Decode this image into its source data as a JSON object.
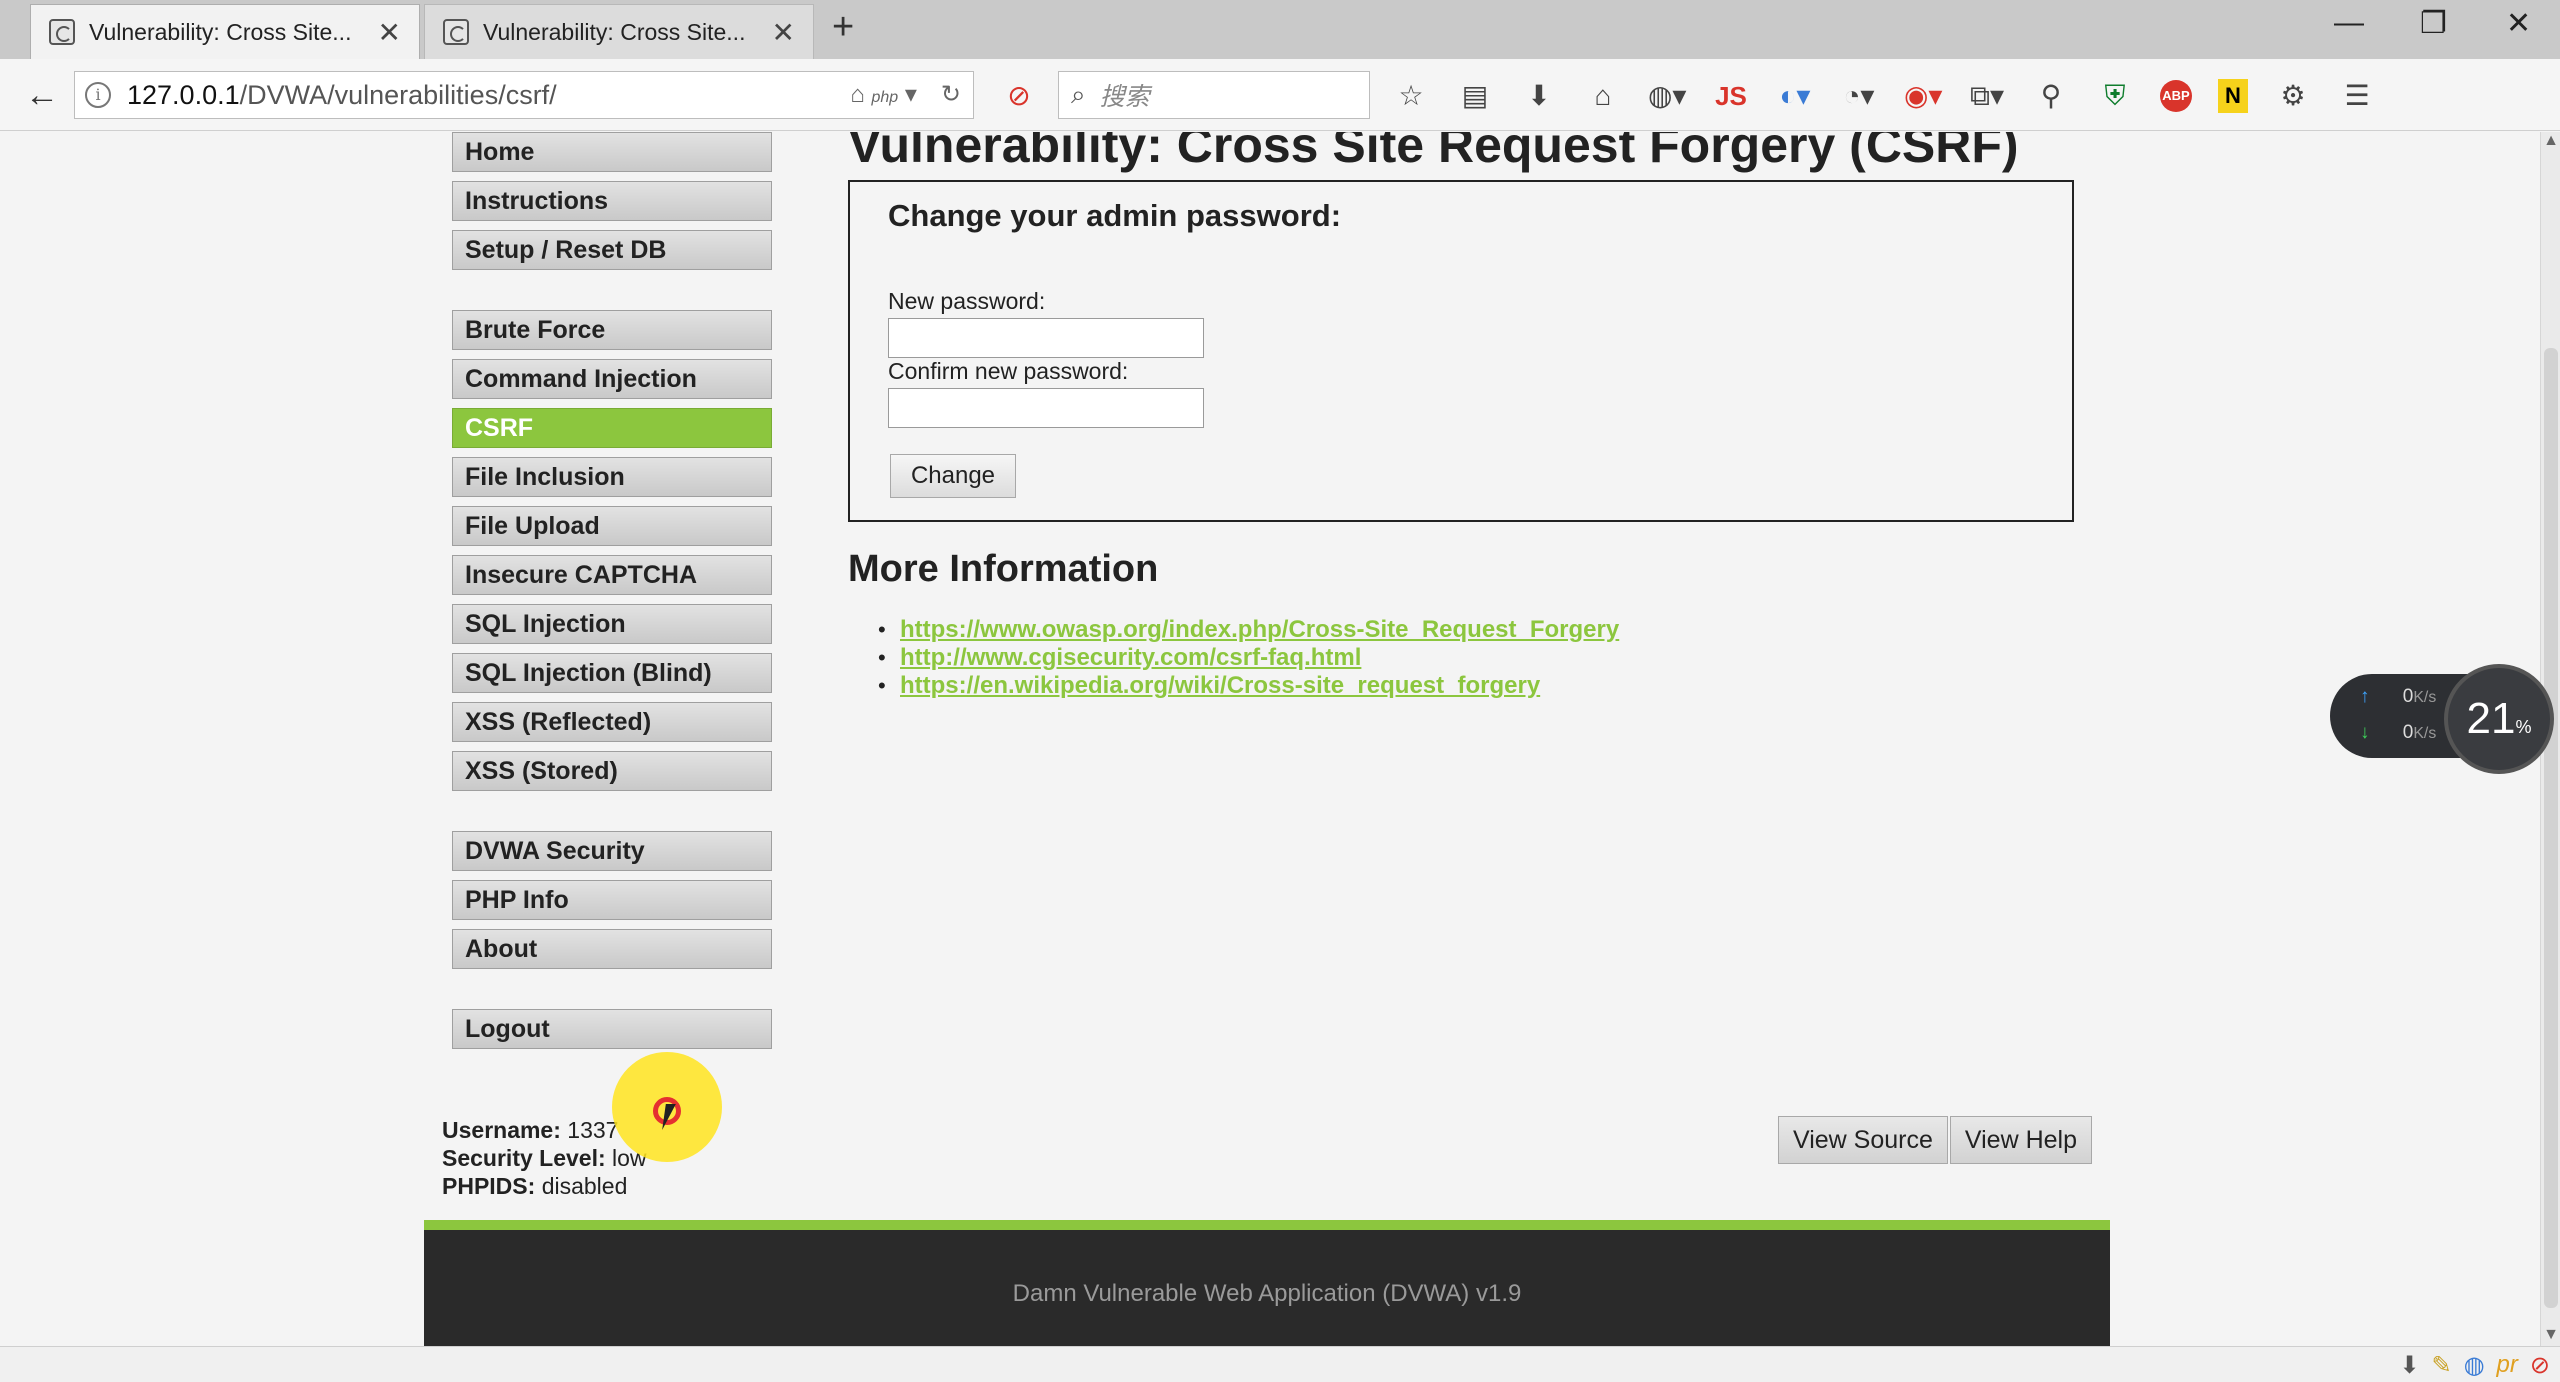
{
  "browser": {
    "tabs": [
      {
        "title": "Vulnerability: Cross Site...",
        "active": true
      },
      {
        "title": "Vulnerability: Cross Site...",
        "active": false
      }
    ],
    "new_tab": "+",
    "window_controls": {
      "minimize": "—",
      "restore": "❐",
      "close": "✕"
    },
    "url_host": "127.0.0.1",
    "url_path": "/DVWA/vulnerabilities/csrf/",
    "url_badge": "php",
    "search_placeholder": "搜索",
    "toolbar_js_label": "JS",
    "toolbar_abp_label": "ABP",
    "toolbar_n_label": "N",
    "icons": [
      "back-icon",
      "info-icon",
      "home-php-icon",
      "reload-icon",
      "noscript-icon",
      "search-icon",
      "bookmark-star-icon",
      "reader-icon",
      "download-icon",
      "home-icon",
      "globe-icon",
      "js-icon",
      "translate-icon",
      "palette-icon",
      "color-icon",
      "share-icon",
      "zoom-icon",
      "shield-icon",
      "abp-icon",
      "n-icon",
      "settings-icon",
      "menu-icon"
    ]
  },
  "sidebar": {
    "groups": [
      [
        "Home",
        "Instructions",
        "Setup / Reset DB"
      ],
      [
        "Brute Force",
        "Command Injection",
        "CSRF",
        "File Inclusion",
        "File Upload",
        "Insecure CAPTCHA",
        "SQL Injection",
        "SQL Injection (Blind)",
        "XSS (Reflected)",
        "XSS (Stored)"
      ],
      [
        "DVWA Security",
        "PHP Info",
        "About"
      ],
      [
        "Logout"
      ]
    ],
    "active": "CSRF"
  },
  "main": {
    "title": "Vulnerability: Cross Site Request Forgery (CSRF)",
    "form": {
      "heading": "Change your admin password:",
      "new_password_label": "New password:",
      "new_password_value": "",
      "confirm_password_label": "Confirm new password:",
      "confirm_password_value": "",
      "submit_label": "Change"
    },
    "more_info": {
      "heading": "More Information",
      "links": [
        "https://www.owasp.org/index.php/Cross-Site_Request_Forgery",
        "http://www.cgisecurity.com/csrf-faq.html",
        "https://en.wikipedia.org/wiki/Cross-site_request_forgery"
      ]
    }
  },
  "userinfo": {
    "username_label": "Username:",
    "username": "1337",
    "security_label": "Security Level:",
    "security": "low",
    "phpids_label": "PHPIDS:",
    "phpids": "disabled"
  },
  "buttons": {
    "view_source": "View Source",
    "view_help": "View Help"
  },
  "footer": {
    "text": "Damn Vulnerable Web Application (DVWA) v1.9"
  },
  "net_widget": {
    "up": "0",
    "down": "0",
    "unit": "K/s",
    "percent": "21",
    "percent_unit": "%"
  },
  "colors": {
    "accent": "#8cc63e",
    "footer_bg": "#2a2a2a"
  }
}
